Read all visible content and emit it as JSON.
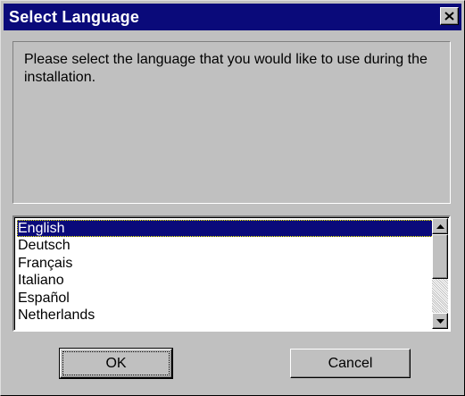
{
  "window": {
    "title": "Select Language",
    "close_icon": "close-icon"
  },
  "message": {
    "text": "Please select the language that you would like to use during the installation."
  },
  "language_list": {
    "selected": "English",
    "items": [
      {
        "label": "English"
      },
      {
        "label": "Deutsch"
      },
      {
        "label": "Français"
      },
      {
        "label": "Italiano"
      },
      {
        "label": "Español"
      },
      {
        "label": "Netherlands"
      }
    ]
  },
  "buttons": {
    "ok_label": "OK",
    "cancel_label": "Cancel"
  },
  "colors": {
    "titlebar": "#0a0a7a",
    "face": "#c0c0c0",
    "selection": "#0a0a7a"
  }
}
